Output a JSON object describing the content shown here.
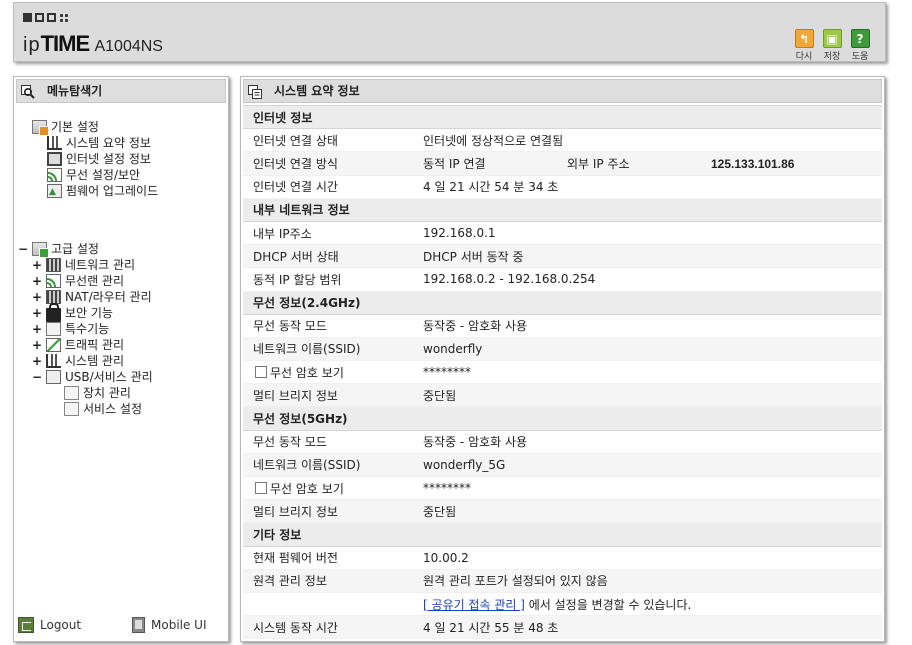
{
  "header": {
    "brand_ip": "ip",
    "brand_time": "TIME",
    "model": "A1004NS",
    "tools": [
      {
        "icon": "back-icon",
        "label": "다시"
      },
      {
        "icon": "save-icon",
        "label": "저장"
      },
      {
        "icon": "help-icon",
        "label": "도움"
      }
    ]
  },
  "left": {
    "title": "메뉴탐색기",
    "basic": {
      "label": "기본 설정",
      "items": [
        "시스템 요약 정보",
        "인터넷 설정 정보",
        "무선 설정/보안",
        "펌웨어 업그레이드"
      ]
    },
    "advanced": {
      "toggle": "−",
      "label": "고급 설정",
      "items": [
        {
          "pm": "+",
          "label": "네트워크 관리"
        },
        {
          "pm": "+",
          "label": "무선랜 관리"
        },
        {
          "pm": "+",
          "label": "NAT/라우터 관리"
        },
        {
          "pm": "+",
          "label": "보안 기능"
        },
        {
          "pm": "+",
          "label": "특수기능"
        },
        {
          "pm": "+",
          "label": "트래픽 관리"
        },
        {
          "pm": "+",
          "label": "시스템 관리"
        },
        {
          "pm": "−",
          "label": "USB/서비스 관리"
        }
      ],
      "usb_children": [
        "장치 관리",
        "서비스 설정"
      ]
    },
    "logout": "Logout",
    "mobile": "Mobile UI"
  },
  "main": {
    "title": "시스템 요약 정보",
    "internet": {
      "section": "인터넷 정보",
      "status_label": "인터넷 연결 상태",
      "status_value": "인터넷에 정상적으로 연결됨",
      "method_label": "인터넷 연결 방식",
      "method_value": "동적 IP 연결",
      "wan_ip_label": "외부 IP 주소",
      "wan_ip_value": "125.133.101.86",
      "time_label": "인터넷 연결 시간",
      "time_value": "4 일 21 시간 54 분 34 초"
    },
    "lan": {
      "section": "내부 네트워크 정보",
      "ip_label": "내부 IP주소",
      "ip_value": "192.168.0.1",
      "dhcp_label": "DHCP 서버 상태",
      "dhcp_value": "DHCP 서버 동작 중",
      "range_label": "동적 IP 할당 범위",
      "range_value": "192.168.0.2 -  192.168.0.254"
    },
    "wifi24": {
      "section": "무선 정보(2.4GHz)",
      "mode_label": "무선 동작 모드",
      "mode_value": "동작중 - 암호화 사용",
      "ssid_label": "네트워크 이름(SSID)",
      "ssid_value": "wonderfly",
      "pw_label": "무선 암호 보기",
      "pw_value": "********",
      "bridge_label": "멀티 브리지 정보",
      "bridge_value": "중단됨"
    },
    "wifi5": {
      "section": "무선 정보(5GHz)",
      "mode_label": "무선 동작 모드",
      "mode_value": "동작중 - 암호화 사용",
      "ssid_label": "네트워크 이름(SSID)",
      "ssid_value": "wonderfly_5G",
      "pw_label": "무선 암호 보기",
      "pw_value": "********",
      "bridge_label": "멀티 브리지 정보",
      "bridge_value": "중단됨"
    },
    "etc": {
      "section": "기타 정보",
      "fw_label": "현재 펌웨어 버전",
      "fw_value": "10.00.2",
      "remote_label": "원격 관리 정보",
      "remote_value": "원격 관리 포트가 설정되어 있지 않음",
      "remote_link": "[ 공유기 접속 관리 ]",
      "remote_hint": " 에서 설정을 변경할 수 있습니다.",
      "uptime_label": "시스템 동작 시간",
      "uptime_value": "4 일 21 시간 55 분 48 초"
    }
  }
}
